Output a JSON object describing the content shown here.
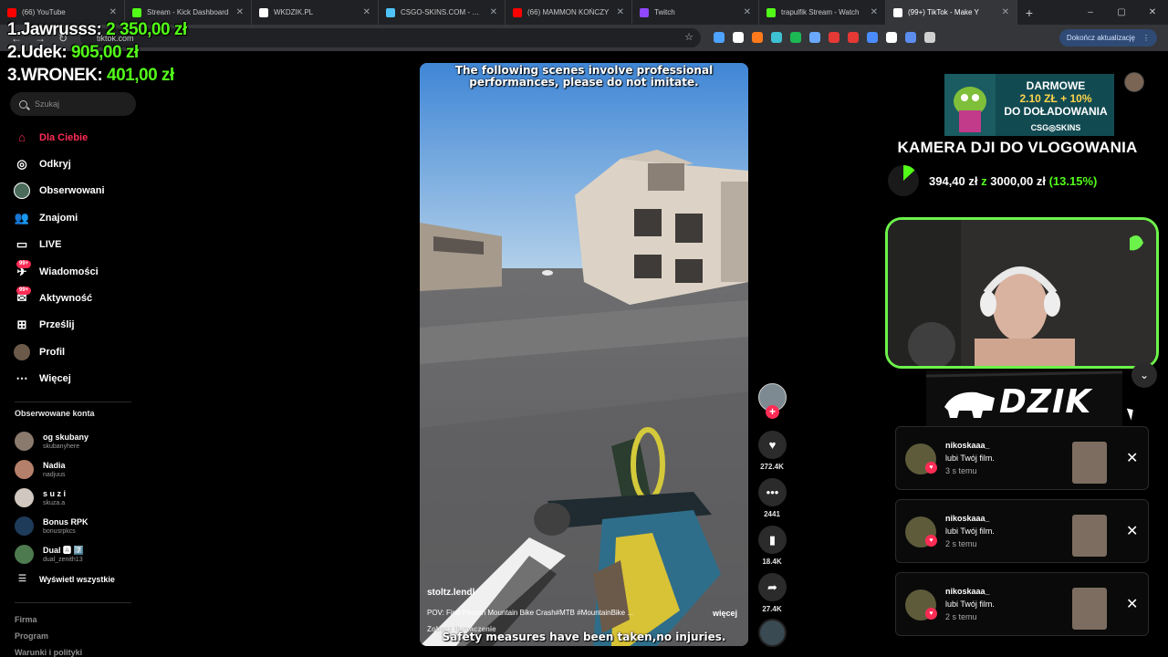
{
  "browser": {
    "tabs": [
      {
        "title": "(66) YouTube",
        "color": "#ff0000"
      },
      {
        "title": "Stream - Kick Dashboard",
        "color": "#53fc18"
      },
      {
        "title": "WKDZIK.PL",
        "color": "#ffffff"
      },
      {
        "title": "CSGO-SKINS.COM - Najle",
        "color": "#4fc3f7"
      },
      {
        "title": "(66) MAMMON KOŃCZY",
        "color": "#ff0000"
      },
      {
        "title": "Twitch",
        "color": "#9146ff"
      },
      {
        "title": "trapulfik Stream - Watch",
        "color": "#53fc18"
      },
      {
        "title": "(99+) TikTok - Make Y",
        "color": "#ffffff",
        "active": true
      }
    ],
    "url": "tiktok.com",
    "update_button": "Dokończ aktualizację",
    "new_tab": "+",
    "window_controls": [
      "–",
      "▢",
      "✕"
    ],
    "extension_colors": [
      "#4da3ff",
      "#ffffff",
      "#ff7a1a",
      "#3ec1d3",
      "#1db954",
      "#6aa9ff",
      "#e53935",
      "#e53935",
      "#4a8cff",
      "#ffffff",
      "#5b8def",
      "#cfcfcf"
    ]
  },
  "leaderboard": [
    {
      "rank": "1.",
      "name": "Jawrusss:",
      "amount": "2 350,00 zł"
    },
    {
      "rank": "2.",
      "name": "Udek:",
      "amount": "905,00 zł"
    },
    {
      "rank": "3.",
      "name": "WRONEK:",
      "amount": "401,00 zł"
    }
  ],
  "sidebar": {
    "search_placeholder": "Szukaj",
    "nav": [
      {
        "label": "Dla Ciebie",
        "icon": "home-icon",
        "active": true
      },
      {
        "label": "Odkryj",
        "icon": "compass-icon"
      },
      {
        "label": "Obserwowani",
        "icon": "following-icon"
      },
      {
        "label": "Znajomi",
        "icon": "friends-icon"
      },
      {
        "label": "LIVE",
        "icon": "live-icon"
      },
      {
        "label": "Wiadomości",
        "icon": "messages-icon",
        "badge": "99+"
      },
      {
        "label": "Aktywność",
        "icon": "activity-icon",
        "badge": "99+"
      },
      {
        "label": "Prześlij",
        "icon": "upload-icon"
      },
      {
        "label": "Profil",
        "icon": "profile-icon"
      },
      {
        "label": "Więcej",
        "icon": "more-icon"
      }
    ],
    "following_title": "Obserwowane konta",
    "following": [
      {
        "name": "og skubany",
        "username": "skubanyhere",
        "color": "#8a7a6e"
      },
      {
        "name": "Nadia",
        "username": "nadjuus",
        "color": "#b5806b"
      },
      {
        "name": "s u z i",
        "username": "skuza.a",
        "color": "#d0c8c0"
      },
      {
        "name": "Bonus RPK",
        "username": "bonusrpkcs",
        "color": "#1f3b5a"
      },
      {
        "name": "Dual 🅰 7️⃣",
        "username": "dual_zenith13",
        "color": "#4d7a4f"
      }
    ],
    "see_all": "Wyświetl wszystkie",
    "footer": [
      "Firma",
      "Program",
      "Warunki i polityki"
    ]
  },
  "video": {
    "caption_top": "The following scenes involve professional performances, please do not imitate.",
    "caption_bottom": "Safety measures have been taken,no injuries.",
    "username": "stoltz.lendl",
    "description": "POV: First Person Mountain Bike Crash#MTB #MountainBike ...",
    "more": "więcej",
    "translate": "Zobacz tłumaczenie"
  },
  "actions": {
    "likes": "272.4K",
    "comments": "2441",
    "saves": "18.4K",
    "shares": "27.4K"
  },
  "overlay": {
    "ad_line1": "DARMOWE",
    "ad_line2": "2.10 ZŁ + 10%",
    "ad_line3": "DO DOŁADOWANIA",
    "ad_logo": "CSG◎SKINS",
    "goal_title": "KAMERA DJI DO VLOGOWANIA",
    "goal_current": "394,40 zł",
    "goal_sep": "z",
    "goal_target": "3000,00 zł",
    "goal_pct_text": "(13.15%)",
    "goal_fraction": 0.1315,
    "dzik_logo": "DZIK",
    "notifications": [
      {
        "user": "nikoskaaa_",
        "action": "lubi Twój film.",
        "time": "3 s temu"
      },
      {
        "user": "nikoskaaa_",
        "action": "lubi Twój film.",
        "time": "2 s temu"
      },
      {
        "user": "nikoskaaa_",
        "action": "lubi Twój film.",
        "time": "2 s temu"
      }
    ]
  }
}
